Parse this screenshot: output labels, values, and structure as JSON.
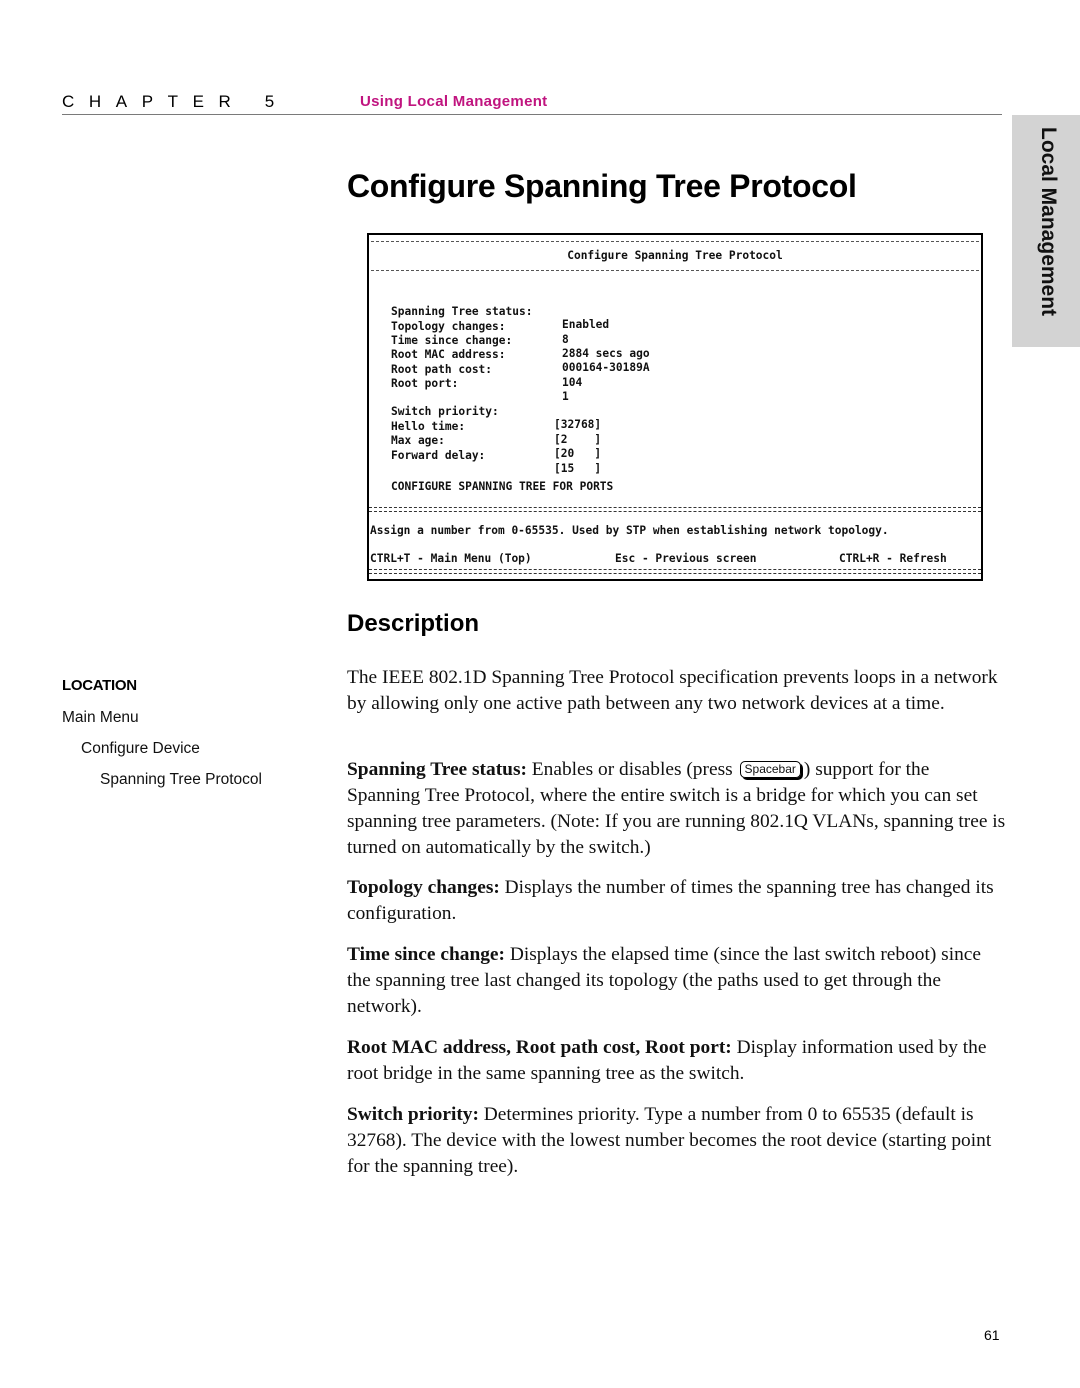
{
  "header": {
    "chapter_label": "CHAPTER 5",
    "chapter_title": "Using Local Management",
    "accent_color": "#c0147f"
  },
  "side_tab": {
    "label": "Local Management"
  },
  "page_title": "Configure Spanning Tree Protocol",
  "terminal": {
    "title": "Configure Spanning Tree Protocol",
    "status_fields": [
      {
        "label": "Spanning Tree status:",
        "value": "Enabled"
      },
      {
        "label": "Topology changes:",
        "value": "8"
      },
      {
        "label": "Time since change:",
        "value": "2884 secs ago"
      },
      {
        "label": "Root MAC address:",
        "value": "000164-30189A"
      },
      {
        "label": "Root path cost:",
        "value": "104"
      },
      {
        "label": "Root port:",
        "value": "1"
      }
    ],
    "input_fields": [
      {
        "label": "Switch priority:",
        "value": "[32768]"
      },
      {
        "label": "Hello time:",
        "value": "[2    ]"
      },
      {
        "label": "Max age:",
        "value": "[20   ]"
      },
      {
        "label": "Forward delay:",
        "value": "[15   ]"
      }
    ],
    "submenu_link": "CONFIGURE SPANNING TREE FOR PORTS",
    "help_text": "Assign a number from 0-65535. Used by STP when establishing network topology.",
    "shortcuts": [
      "CTRL+T - Main Menu (Top)",
      "Esc - Previous screen",
      "CTRL+R - Refresh"
    ]
  },
  "description": {
    "heading": "Description",
    "intro": "The IEEE 802.1D Spanning Tree Protocol specification prevents loops in a network by allowing only one active path between any two network devices at a time.",
    "items": [
      {
        "term": "Spanning Tree status:",
        "text_before_key": " Enables or disables (press ",
        "key": "Spacebar",
        "text_after_key": ") support for the Spanning Tree Protocol, where the entire switch is a bridge for which you can set spanning tree parameters. (Note: If you are running 802.1Q VLANs, spanning tree is turned on automatically by the switch.)"
      },
      {
        "term": "Topology changes:",
        "text": " Displays the number of times the spanning tree has changed its configuration."
      },
      {
        "term": "Time since change:",
        "text": " Displays the elapsed time (since the last switch reboot) since the spanning tree last changed its topology (the paths used to get through the network)."
      },
      {
        "term": "Root MAC address, Root path cost, Root port:",
        "text": " Display information used by the root bridge in the same spanning tree as the switch."
      },
      {
        "term": "Switch priority:",
        "text": " Determines priority. Type a number from 0 to 65535 (default is 32768). The device with the lowest number becomes the root device (starting point for the spanning tree)."
      }
    ]
  },
  "location": {
    "title": "LOCATION",
    "path": [
      "Main Menu",
      "Configure Device",
      "Spanning Tree Protocol"
    ]
  },
  "page_number": "61"
}
